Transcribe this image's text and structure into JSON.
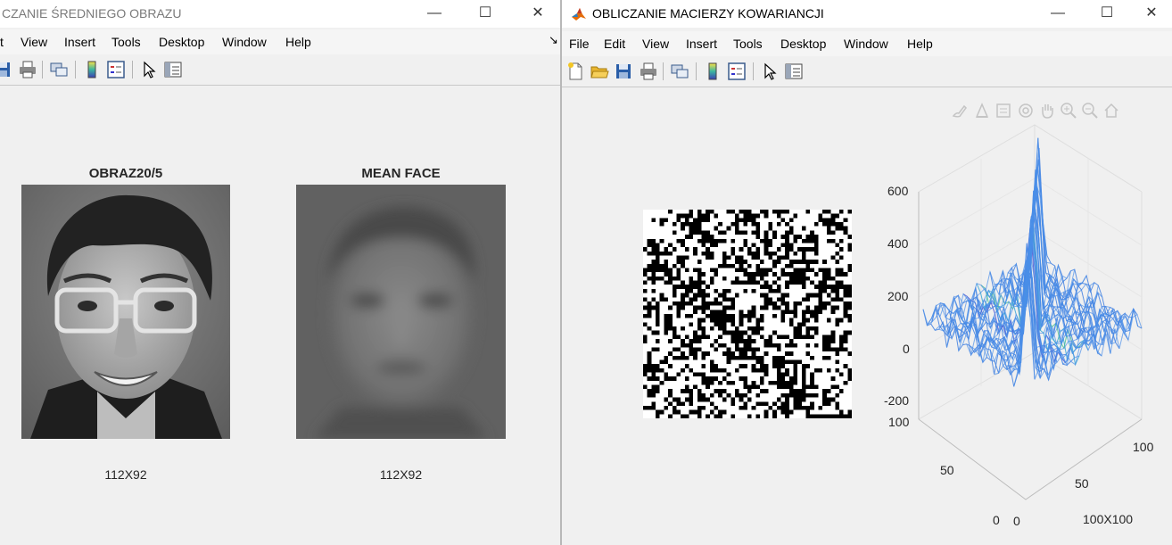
{
  "left_window": {
    "title": "CZANIE ŚREDNIEGO OBRAZU",
    "menu": [
      "t",
      "View",
      "Insert",
      "Tools",
      "Desktop",
      "Window",
      "Help"
    ],
    "dock_arrow": "↘",
    "toolbar_icons": [
      "save-icon",
      "print-icon",
      "link-plot-icon",
      "colorbar-icon",
      "legend-icon",
      "pointer-icon",
      "property-inspector-icon"
    ],
    "axes": [
      {
        "title": "OBRAZ20/5",
        "xlabel": "112X92",
        "image": "grayscale face photograph"
      },
      {
        "title": "MEAN FACE",
        "xlabel": "112X92",
        "image": "blurred mean face"
      }
    ]
  },
  "right_window": {
    "title": "OBLICZANIE MACIERZY KOWARIANCJI",
    "menu": [
      "File",
      "Edit",
      "View",
      "Insert",
      "Tools",
      "Desktop",
      "Window",
      "Help"
    ],
    "toolbar_icons": [
      "new-figure-icon",
      "open-icon",
      "save-icon",
      "print-icon",
      "link-plot-icon",
      "colorbar-icon",
      "legend-icon",
      "pointer-icon",
      "property-inspector-icon"
    ],
    "axes_toolbar_icons": [
      "brush-icon",
      "data-tip-icon",
      "export-icon",
      "rotate-icon",
      "pan-icon",
      "zoom-in-icon",
      "zoom-out-icon",
      "home-icon"
    ],
    "binary_matrix": {
      "image": "black and white binary covariance matrix"
    },
    "surface": {
      "z_ticks": [
        "600",
        "400",
        "200",
        "0",
        "-200"
      ],
      "y_ticks": [
        "100",
        "50",
        "0"
      ],
      "x_ticks": [
        "0",
        "50",
        "100"
      ],
      "xlabel": "100X100"
    }
  },
  "window_controls": {
    "minimize": "—",
    "maximize": "☐",
    "close": "✕"
  }
}
